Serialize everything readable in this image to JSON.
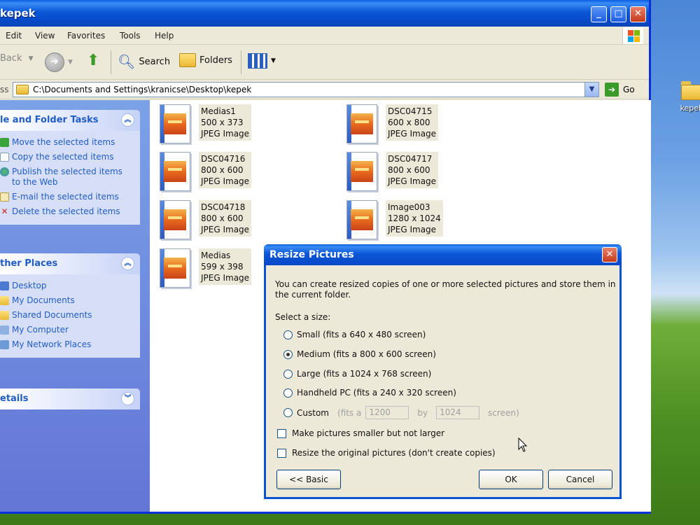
{
  "window": {
    "title": "kepek",
    "minimize": "_",
    "maximize": "□",
    "close": "✕"
  },
  "menu": [
    "Edit",
    "View",
    "Favorites",
    "Tools",
    "Help"
  ],
  "toolbar": {
    "back_label": "Back",
    "search_label": "Search",
    "folders_label": "Folders"
  },
  "address": {
    "label": "ss",
    "path": "C:\\Documents and Settings\\kranicse\\Desktop\\kepek",
    "go_label": "Go"
  },
  "sidebar": {
    "file_tasks": {
      "title": "le and Folder Tasks",
      "items": [
        "Move the selected items",
        "Copy the selected items",
        "Publish the selected items to the Web",
        "E-mail the selected items",
        "Delete the selected items"
      ]
    },
    "other_places": {
      "title": "ther Places",
      "items": [
        "Desktop",
        "My Documents",
        "Shared Documents",
        "My Computer",
        "My Network Places"
      ]
    },
    "details": {
      "title": "etails"
    }
  },
  "files": [
    {
      "name": "Medias1",
      "dims": "500 x 373",
      "type": "JPEG Image"
    },
    {
      "name": "DSC04715",
      "dims": "600 x 800",
      "type": "JPEG Image"
    },
    {
      "name": "DSC04716",
      "dims": "800 x 600",
      "type": "JPEG Image"
    },
    {
      "name": "DSC04717",
      "dims": "800 x 600",
      "type": "JPEG Image"
    },
    {
      "name": "DSC04718",
      "dims": "800 x 600",
      "type": "JPEG Image"
    },
    {
      "name": "Image003",
      "dims": "1280 x 1024",
      "type": "JPEG Image"
    },
    {
      "name": "Medias",
      "dims": "599 x 398",
      "type": "JPEG Image"
    }
  ],
  "dialog": {
    "title": "Resize Pictures",
    "close": "✕",
    "description_line1": "You can create resized copies of one or more selected pictures and store them in",
    "description_line2": "the current folder.",
    "select_label": "Select a size:",
    "options": {
      "small": "Small (fits a 640 x 480 screen)",
      "medium": "Medium (fits a 800 x 600 screen)",
      "large": "Large (fits a 1024 x 768 screen)",
      "handheld": "Handheld PC (fits a 240 x 320 screen)",
      "custom": "Custom"
    },
    "selected": "medium",
    "custom": {
      "fits_a": "(fits a",
      "width": "1200",
      "by": "by",
      "height": "1024",
      "screen": "screen)"
    },
    "check_smaller": "Make pictures smaller but not larger",
    "check_original": "Resize the original pictures (don't create copies)",
    "basic_button": "<< Basic",
    "ok_button": "OK",
    "cancel_button": "Cancel"
  },
  "desktop": {
    "icon_label": "kepek"
  }
}
